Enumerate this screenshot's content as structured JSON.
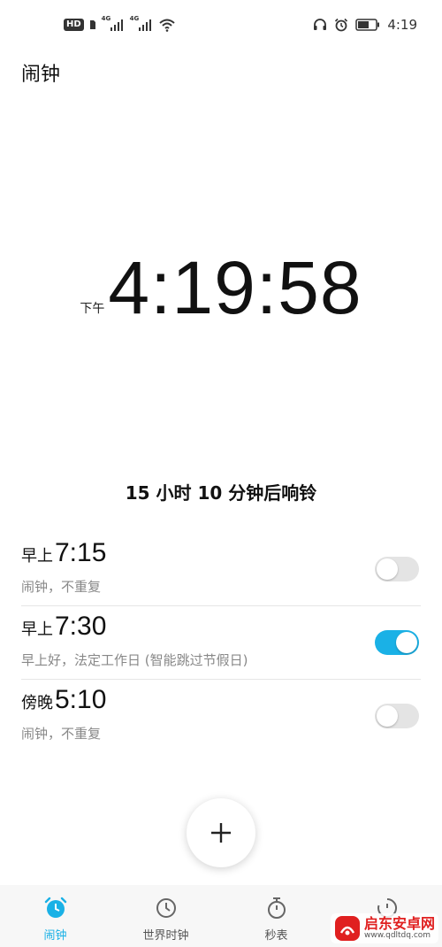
{
  "status_bar": {
    "hd": "HD",
    "network1": "4G",
    "network2": "4G",
    "time": "4:19",
    "icons": [
      "headset-icon",
      "alarm-icon",
      "battery-icon",
      "wifi-icon",
      "signal-icon"
    ]
  },
  "title": "闹钟",
  "clock": {
    "ampm": "下午",
    "time": "4:19:58"
  },
  "next_ring": "15 小时 10 分钟后响铃",
  "alarms": [
    {
      "period": "早上",
      "time": "7:15",
      "desc": "闹钟，不重复",
      "enabled": false
    },
    {
      "period": "早上",
      "time": "7:30",
      "desc": "早上好，法定工作日 (智能跳过节假日)",
      "enabled": true
    },
    {
      "period": "傍晚",
      "time": "5:10",
      "desc": "闹钟，不重复",
      "enabled": false
    }
  ],
  "fab_icon": "plus-icon",
  "nav": [
    {
      "label": "闹钟",
      "icon": "alarm-clock-icon",
      "active": true
    },
    {
      "label": "世界时钟",
      "icon": "world-clock-icon",
      "active": false
    },
    {
      "label": "秒表",
      "icon": "stopwatch-icon",
      "active": false
    },
    {
      "label": "",
      "icon": "timer-icon",
      "active": false
    }
  ],
  "watermark": {
    "title": "启东安卓网",
    "url": "www.qdltdq.com"
  },
  "colors": {
    "accent": "#1ab1e6",
    "toggle_off": "#e4e4e4",
    "desc_text": "#888888",
    "watermark_red": "#e02020"
  }
}
